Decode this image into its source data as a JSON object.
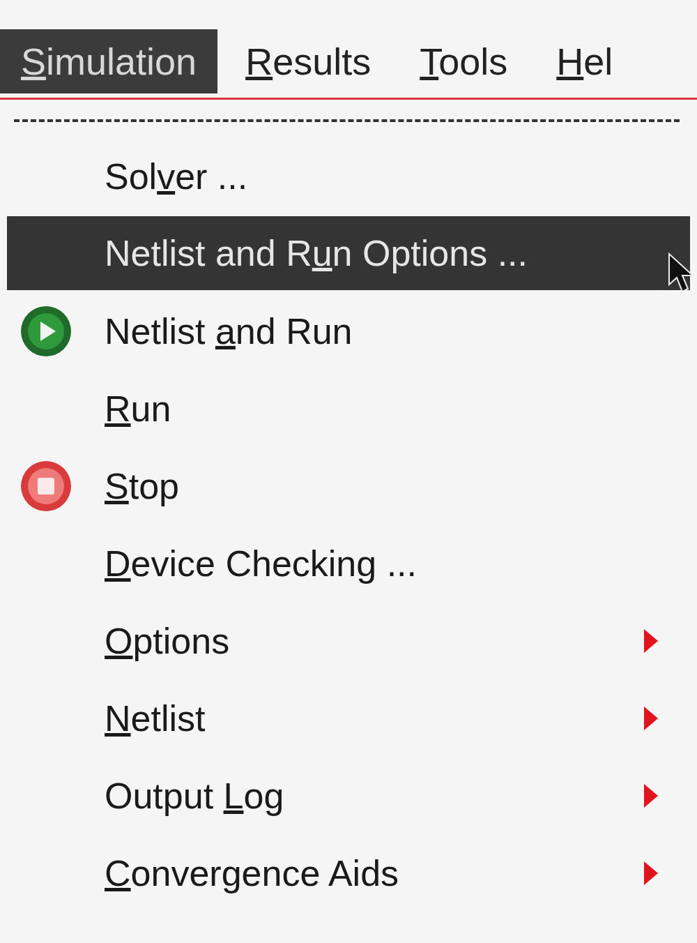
{
  "menubar": [
    {
      "underlined": "S",
      "after": "imulation",
      "selected": true
    },
    {
      "underlined": "R",
      "after": "esults",
      "selected": false
    },
    {
      "underlined": "T",
      "after": "ools",
      "selected": false
    },
    {
      "underlined": "H",
      "after": "el",
      "selected": false
    }
  ],
  "menu": {
    "items": [
      {
        "kind": "command",
        "before": "Sol",
        "underlined": "v",
        "after": "er ...",
        "selected": false
      },
      {
        "kind": "command",
        "before": "Netlist and R",
        "underlined": "u",
        "after": "n Options ...",
        "selected": true
      },
      {
        "kind": "play",
        "before": "Netlist ",
        "underlined": "a",
        "after": "nd Run",
        "selected": false
      },
      {
        "kind": "command",
        "underlined": "R",
        "after": "un",
        "selected": false
      },
      {
        "kind": "stop",
        "underlined": "S",
        "after": "top",
        "selected": false
      },
      {
        "kind": "command",
        "underlined": "D",
        "after": "evice Checking ...",
        "selected": false
      },
      {
        "kind": "submenu",
        "underlined": "O",
        "after": "ptions",
        "selected": false
      },
      {
        "kind": "submenu",
        "underlined": "N",
        "after": "etlist",
        "selected": false
      },
      {
        "kind": "submenu",
        "before": "Output ",
        "underlined": "L",
        "after": "og",
        "selected": false
      },
      {
        "kind": "submenu",
        "underlined": "C",
        "after": "onvergence Aids",
        "selected": false
      }
    ]
  }
}
